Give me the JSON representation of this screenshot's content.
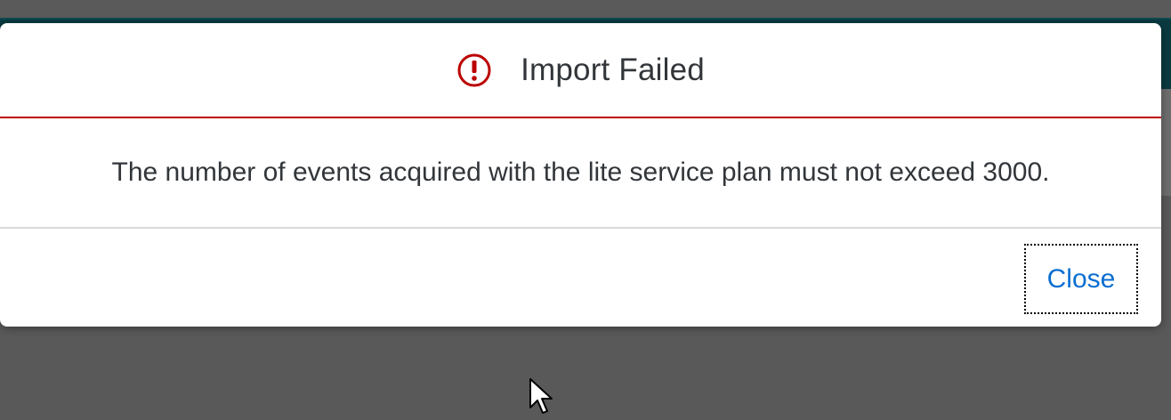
{
  "dialog": {
    "title": "Import Failed",
    "state": "error",
    "message": "The number of events acquired with the lite service plan must not exceed 3000.",
    "close_label": "Close",
    "icon": "error-icon"
  },
  "colors": {
    "error": "#bb0000",
    "text": "#32363a",
    "link": "#0a6ed1",
    "backdrop": "#595959",
    "shellbar": "#0a3a40"
  }
}
